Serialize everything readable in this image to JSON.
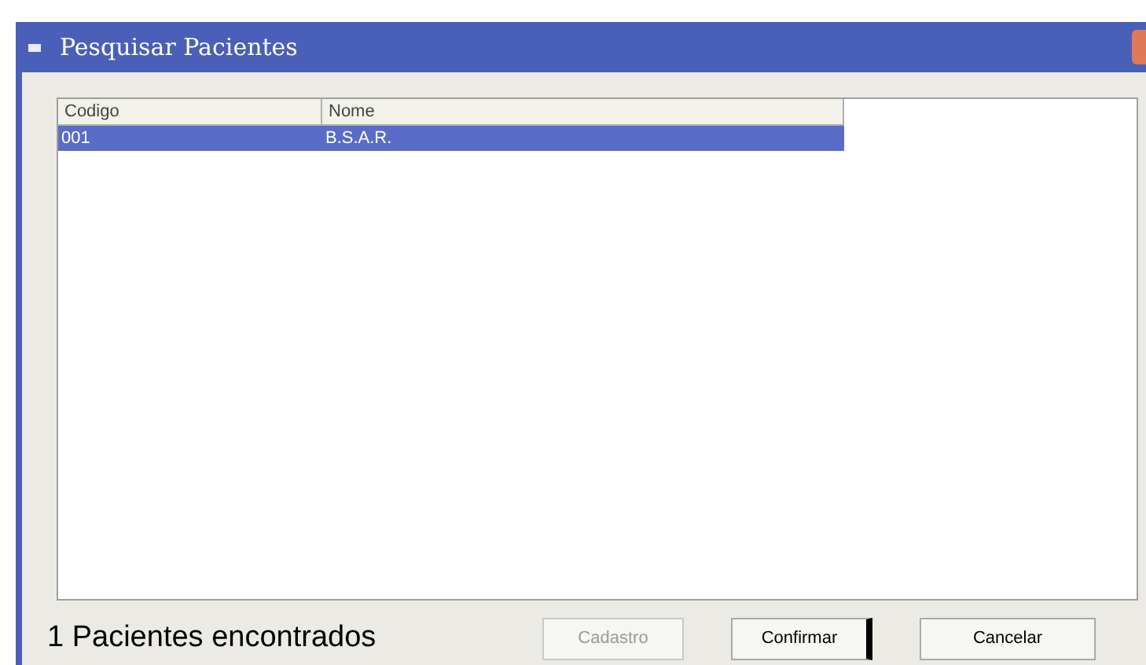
{
  "window": {
    "title": "Pesquisar Pacientes"
  },
  "table": {
    "columns": [
      "Codigo",
      "Nome"
    ],
    "rows": [
      {
        "cells": [
          "001",
          "B.S.A.R."
        ],
        "selected": true
      }
    ]
  },
  "status": "1 Pacientes encontrados",
  "buttons": [
    {
      "label": "Cadastro",
      "disabled": true,
      "default": false
    },
    {
      "label": "Confirmar",
      "disabled": false,
      "default": true
    },
    {
      "label": "Cancelar",
      "disabled": false,
      "default": false
    }
  ]
}
